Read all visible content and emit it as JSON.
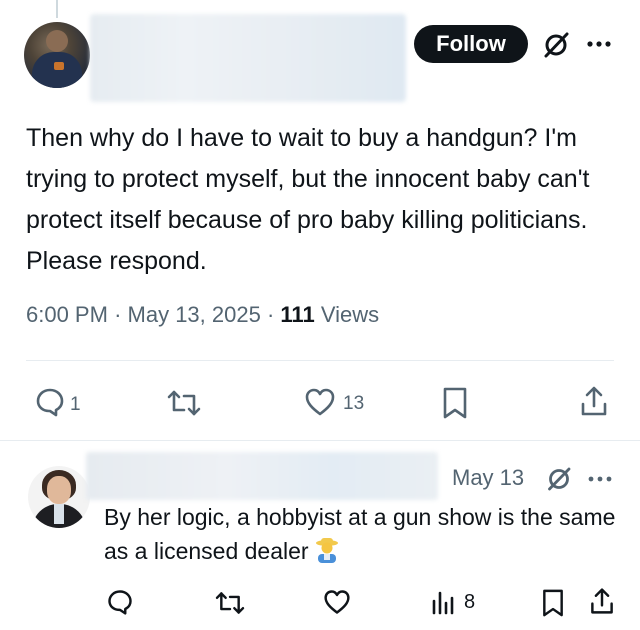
{
  "main_tweet": {
    "follow_label": "Follow",
    "text": "Then why do I have to wait to buy a handgun? I'm trying to protect myself, but the innocent baby can't protect itself because of pro  baby killing politicians. Please respond.",
    "time": "6:00 PM",
    "separator": "·",
    "date": "May 13, 2025",
    "views_count": "111",
    "views_label": "Views",
    "actions": {
      "reply_count": "1",
      "retweet_count": "",
      "like_count": "13"
    }
  },
  "reply_tweet": {
    "date": "May 13",
    "text": "By her logic, a hobbyist at a gun show is the same as a licensed dealer",
    "emoji_icon": "man-farmer-emoji",
    "actions": {
      "views_count": "8"
    }
  },
  "colors": {
    "text_primary": "#0f1419",
    "text_secondary": "#536471",
    "follow_button_bg": "#0f1419",
    "divider": "#e7ecf0"
  }
}
